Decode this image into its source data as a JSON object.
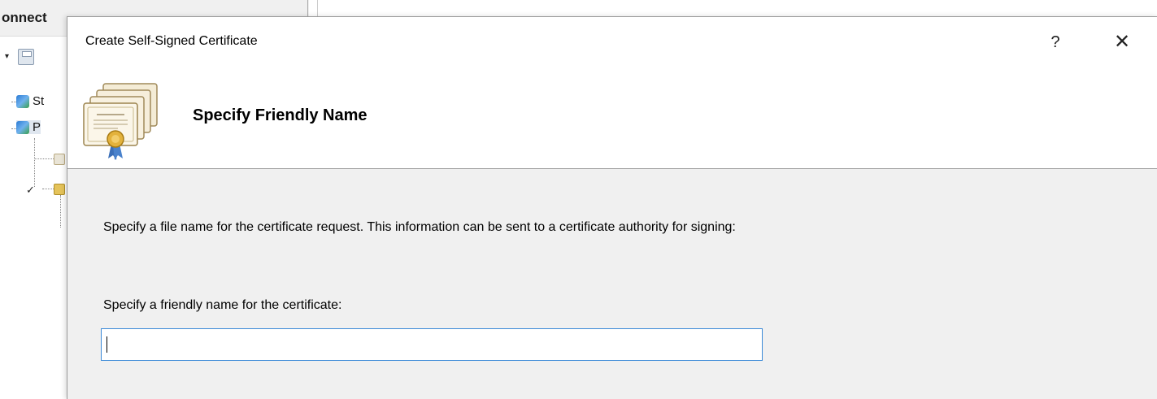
{
  "background": {
    "panel_title": "onnect",
    "tree_items": [
      {
        "label": "St"
      },
      {
        "label": "P"
      }
    ]
  },
  "dialog": {
    "title": "Create Self-Signed Certificate",
    "help_label": "?",
    "close_label": "✕",
    "heading": "Specify Friendly Name",
    "instructions": "Specify a file name for the certificate request.  This information can be sent to a certificate authority for signing:",
    "field_label": "Specify a friendly name for the certificate:",
    "friendly_name_value": "",
    "icon": "certificate-icon"
  }
}
